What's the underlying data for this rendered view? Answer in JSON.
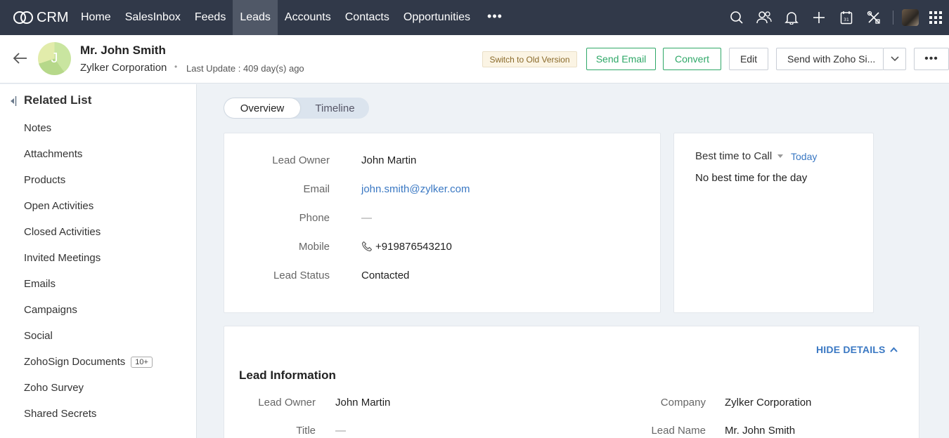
{
  "brand": {
    "name": "CRM"
  },
  "nav": {
    "items": [
      {
        "label": "Home"
      },
      {
        "label": "SalesInbox"
      },
      {
        "label": "Feeds"
      },
      {
        "label": "Leads",
        "active": true
      },
      {
        "label": "Accounts"
      },
      {
        "label": "Contacts"
      },
      {
        "label": "Opportunities"
      }
    ],
    "more": "•••",
    "icons": [
      "search-icon",
      "users-icon",
      "bell-icon",
      "plus-icon",
      "calendar-icon",
      "tools-icon",
      "user-avatar",
      "apps-grid-icon"
    ]
  },
  "header": {
    "avatar_initial": "J",
    "name": "Mr. John Smith",
    "company": "Zylker Corporation",
    "separator": "•",
    "last_update": "Last Update : 409 day(s) ago",
    "buttons": {
      "old_version": "Switch to Old Version",
      "send_email": "Send Email",
      "convert": "Convert",
      "edit": "Edit",
      "send_with_sign": "Send with Zoho Si...",
      "more": "•••"
    }
  },
  "sidebar": {
    "title": "Related List",
    "items": [
      {
        "label": "Notes"
      },
      {
        "label": "Attachments"
      },
      {
        "label": "Products"
      },
      {
        "label": "Open Activities"
      },
      {
        "label": "Closed Activities"
      },
      {
        "label": "Invited Meetings"
      },
      {
        "label": "Emails"
      },
      {
        "label": "Campaigns"
      },
      {
        "label": "Social"
      },
      {
        "label": "ZohoSign Documents",
        "badge": "10+"
      },
      {
        "label": "Zoho Survey"
      },
      {
        "label": "Shared Secrets"
      }
    ]
  },
  "tabs": {
    "overview": "Overview",
    "timeline": "Timeline"
  },
  "overview": {
    "fields": [
      {
        "label": "Lead Owner",
        "value": "John Martin"
      },
      {
        "label": "Email",
        "value": "john.smith@zylker.com"
      },
      {
        "label": "Phone",
        "value": "—"
      },
      {
        "label": "Mobile",
        "value": "+919876543210"
      },
      {
        "label": "Lead Status",
        "value": "Contacted"
      }
    ]
  },
  "best_time": {
    "label": "Best time to Call",
    "today": "Today",
    "message": "No best time for the day"
  },
  "lead_info": {
    "hide_details": "HIDE DETAILS",
    "title": "Lead Information",
    "left": [
      {
        "label": "Lead Owner",
        "value": "John Martin"
      },
      {
        "label": "Title",
        "value": "—"
      }
    ],
    "right": [
      {
        "label": "Company",
        "value": "Zylker Corporation"
      },
      {
        "label": "Lead Name",
        "value": "Mr. John Smith"
      }
    ]
  },
  "colors": {
    "nav_bg": "#313949",
    "nav_active": "#505867",
    "accent_green": "#2fa868",
    "link_blue": "#3a78c3"
  }
}
